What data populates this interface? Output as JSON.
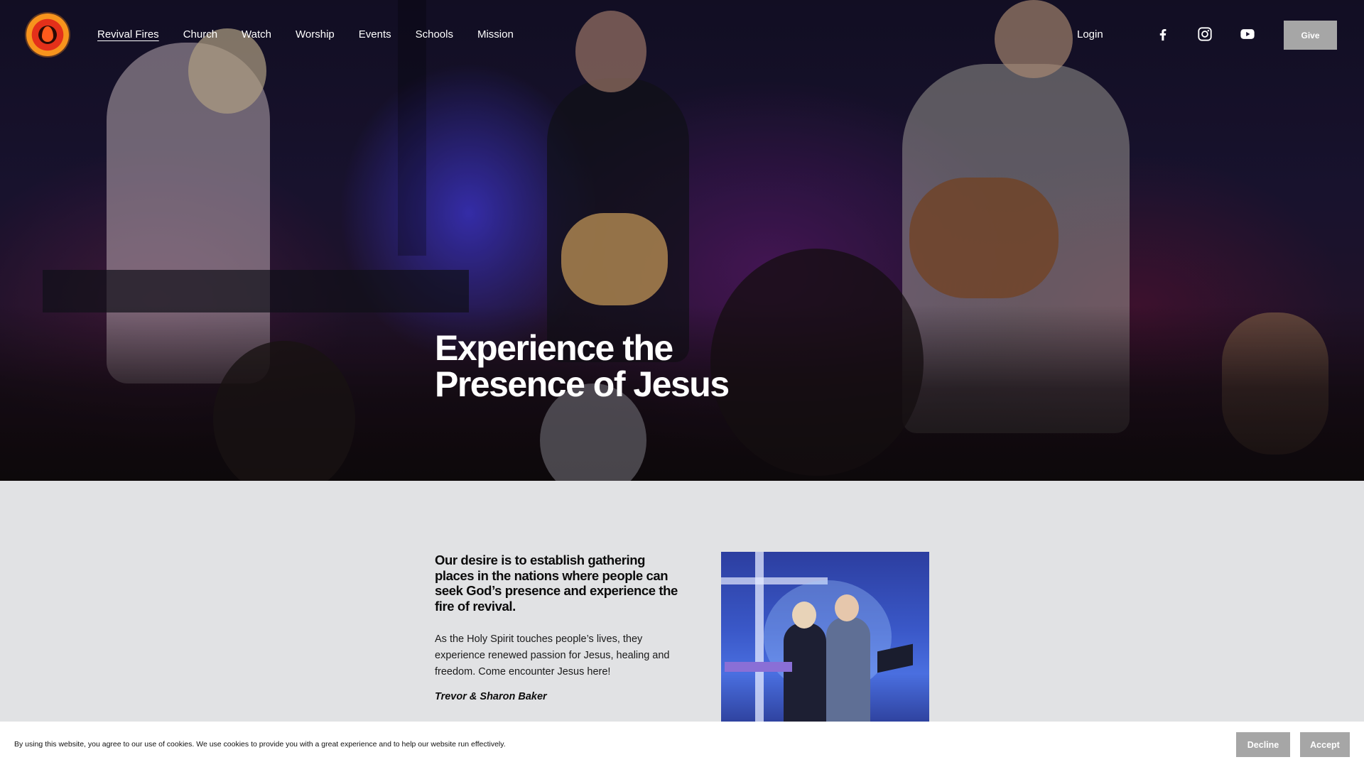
{
  "nav": {
    "brand_name": "Revival Fires",
    "items": [
      {
        "label": "Revival Fires",
        "active": true
      },
      {
        "label": "Church",
        "active": false
      },
      {
        "label": "Watch",
        "active": false
      },
      {
        "label": "Worship",
        "active": false
      },
      {
        "label": "Events",
        "active": false
      },
      {
        "label": "Schools",
        "active": false
      },
      {
        "label": "Mission",
        "active": false
      }
    ],
    "login_label": "Login",
    "social_icons": [
      "facebook-icon",
      "instagram-icon",
      "youtube-icon"
    ],
    "give_label": "Give"
  },
  "hero": {
    "title_line1": "Experience the",
    "title_line2": "Presence of Jesus"
  },
  "intro": {
    "heading": "Our desire is to establish gathering places in the nations where people can seek God’s presence and experience the fire of revival.",
    "body": "As the Holy Spirit touches people’s lives, they experience renewed passion for Jesus, healing and freedom. Come encounter Jesus here!",
    "signature": "Trevor & Sharon Baker"
  },
  "cookie": {
    "text": "By using this website, you agree to our use of cookies. We use cookies to provide you with a great experience and to help our website run effectively.",
    "decline_label": "Decline",
    "accept_label": "Accept"
  },
  "colors": {
    "page_background": "#e1e2e4",
    "button_gray": "#a6a6a6",
    "logo_orange": "#f7941d",
    "logo_red": "#e4301a"
  }
}
